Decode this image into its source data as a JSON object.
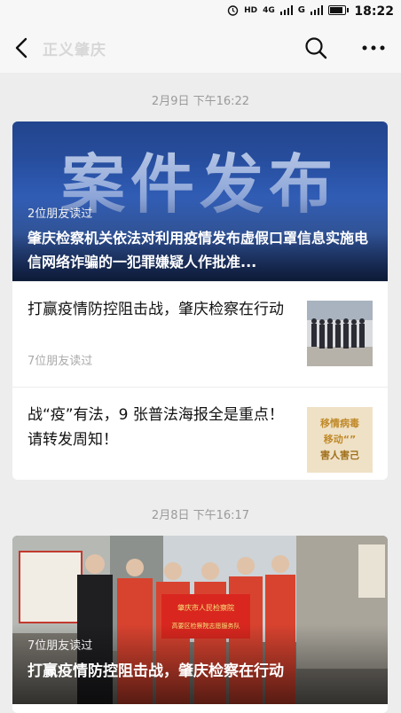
{
  "status_bar": {
    "time": "18:22",
    "network": "4G",
    "carrier_mark": "G",
    "battery_level": 0.85,
    "icons": [
      "alarm-icon",
      "hd-icon",
      "signal-icon",
      "battery-icon"
    ]
  },
  "header": {
    "title": "正义肇庆",
    "icons": [
      "back-arrow-icon",
      "search-icon",
      "more-icon"
    ]
  },
  "groups": [
    {
      "date": "2月9日 下午16:22",
      "hero": {
        "image_text": "案件发布",
        "read_count": "2位朋友读过",
        "headline": "肇庆检察机关依法对利用疫情发布虚假口罩信息实施电信网络诈骗的一犯罪嫌疑人作批准..."
      },
      "items": [
        {
          "title": "打赢疫情防控阻击战，肇庆检察在行动",
          "meta": "7位朋友读过"
        },
        {
          "title": "战“疫”有法，9 张普法海报全是重点！请转发周知！",
          "meta": "",
          "thumb_text_line1": "移情病毒",
          "thumb_text_line2": "移动“”",
          "thumb_text_line3": "害人害己"
        }
      ]
    },
    {
      "date": "2月8日 下午16:17",
      "hero": {
        "banner_text": "肇庆市人民检察院",
        "banner_sub": "高要区检察院志愿服务队",
        "read_count": "7位朋友读过",
        "headline": "打赢疫情防控阻击战，肇庆检察在行动"
      }
    }
  ],
  "colors": {
    "background": "#ededed",
    "card": "#ffffff",
    "hero_blue": "#2f5bb3",
    "vest_red": "#d8432f"
  }
}
